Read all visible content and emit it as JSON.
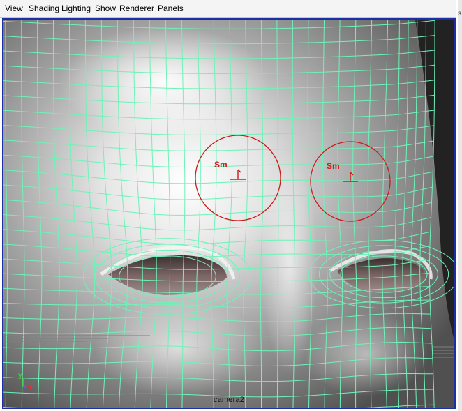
{
  "menubar": {
    "items": [
      {
        "label": "View"
      },
      {
        "label": "Shading"
      },
      {
        "label": "Lighting"
      },
      {
        "label": "Show"
      },
      {
        "label": "Renderer"
      },
      {
        "label": "Panels"
      }
    ]
  },
  "viewport": {
    "camera_label": "camera2",
    "wireframe_color": "#6ff2b8",
    "manipulator_color": "#cc1a1a",
    "manipulators": [
      {
        "label": "Sm"
      },
      {
        "label": "Sm"
      }
    ],
    "axis_gizmo": {
      "y": "y",
      "z": "z",
      "x": "x"
    }
  },
  "right_strip": {
    "char": "s"
  }
}
